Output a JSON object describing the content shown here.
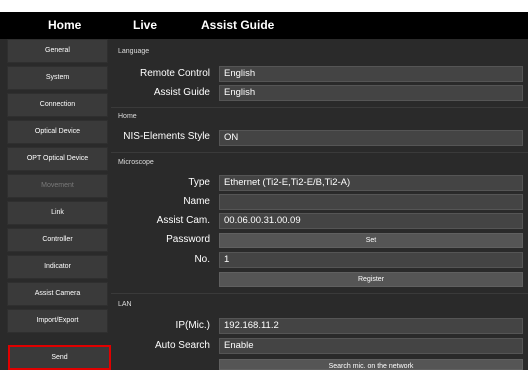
{
  "topbar": {
    "home": "Home",
    "live": "Live",
    "assist_guide": "Assist Guide"
  },
  "sidebar": {
    "items": [
      {
        "label": "General"
      },
      {
        "label": "System"
      },
      {
        "label": "Connection"
      },
      {
        "label": "Optical Device"
      },
      {
        "label": "OPT Optical Device"
      },
      {
        "label": "Movement"
      },
      {
        "label": "Link"
      },
      {
        "label": "Controller"
      },
      {
        "label": "Indicator"
      },
      {
        "label": "Assist Camera"
      },
      {
        "label": "Import/Export"
      },
      {
        "label": "Send"
      }
    ]
  },
  "language": {
    "title": "Language",
    "remote_control_label": "Remote Control",
    "remote_control_value": "English",
    "assist_guide_label": "Assist Guide",
    "assist_guide_value": "English"
  },
  "home": {
    "title": "Home",
    "nis_label": "NIS-Elements Style",
    "nis_value": "ON"
  },
  "microscope": {
    "title": "Microscope",
    "type_label": "Type",
    "type_value": "Ethernet (Ti2-E,Ti2-E/B,Ti2-A)",
    "name_label": "Name",
    "name_value": "",
    "assist_cam_label": "Assist Cam.",
    "assist_cam_value": "00.06.00.31.00.09",
    "password_label": "Password",
    "set_button": "Set",
    "no_label": "No.",
    "no_value": "1",
    "register_button": "Register"
  },
  "lan": {
    "title": "LAN",
    "ip_label": "IP(Mic.)",
    "ip_value": "192.168.11.2",
    "auto_search_label": "Auto Search",
    "auto_search_value": "Enable",
    "search_button": "Search mic. on the network"
  }
}
